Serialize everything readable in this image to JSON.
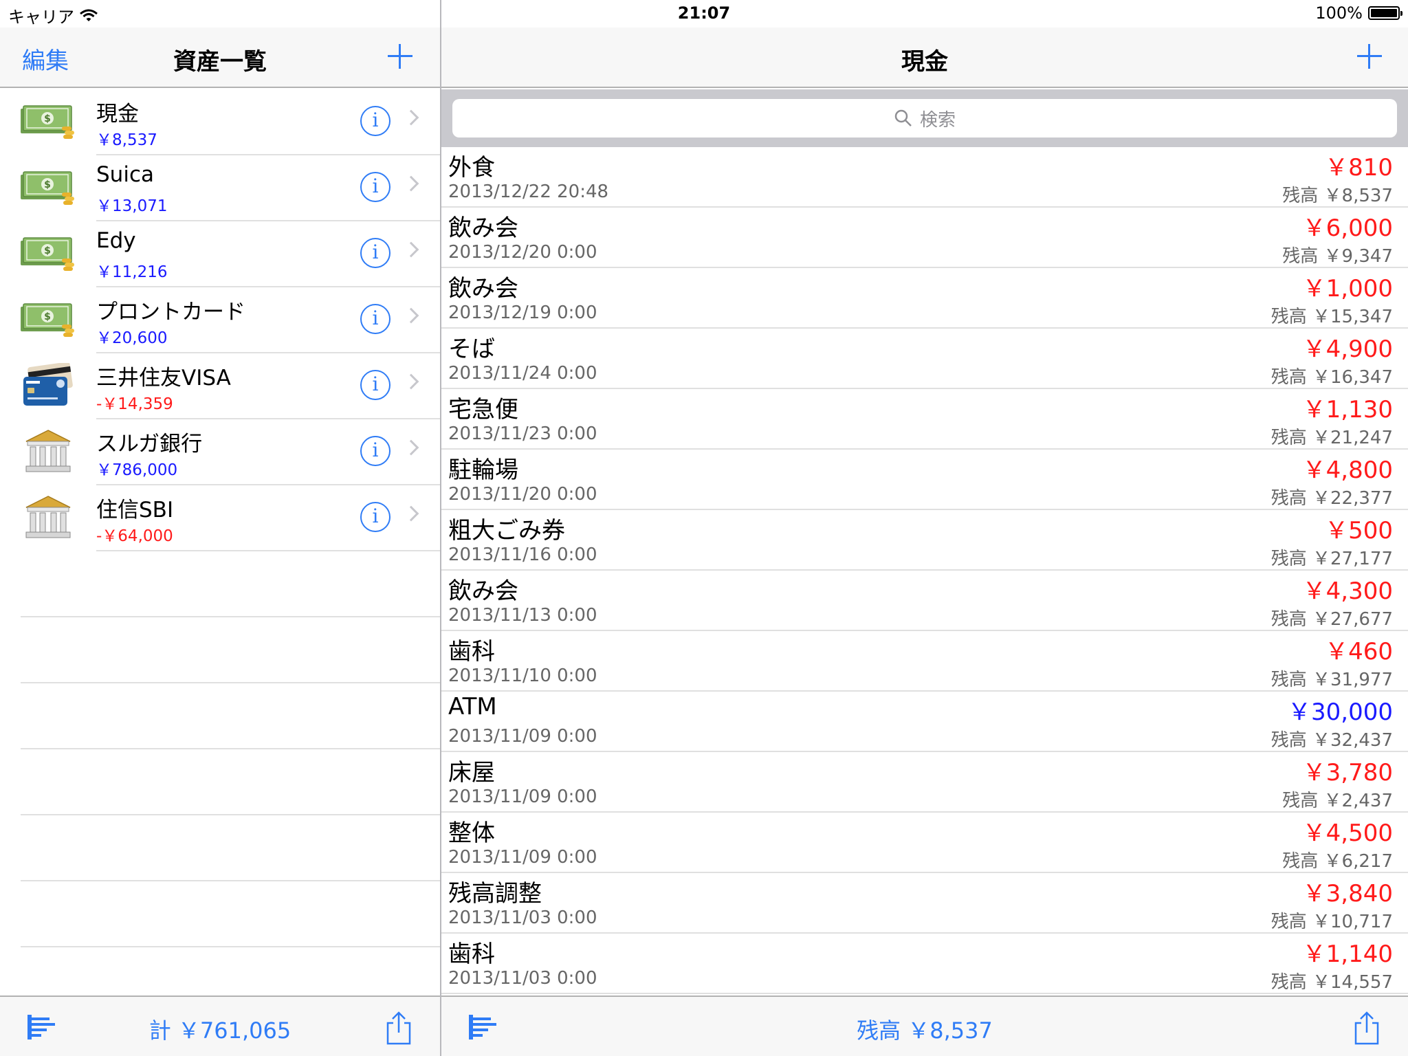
{
  "status": {
    "carrier": "キャリア",
    "time": "21:07",
    "battery": "100%"
  },
  "left": {
    "nav": {
      "edit_label": "編集",
      "title": "資産一覧"
    },
    "assets": [
      {
        "name": "現金",
        "amount": "￥8,537",
        "type": "cash"
      },
      {
        "name": "Suica",
        "amount": "￥13,071",
        "type": "cash"
      },
      {
        "name": "Edy",
        "amount": "￥11,216",
        "type": "cash"
      },
      {
        "name": "プロントカード",
        "amount": "￥20,600",
        "type": "cash"
      },
      {
        "name": "三井住友VISA",
        "amount": "-￥14,359",
        "type": "card"
      },
      {
        "name": "スルガ銀行",
        "amount": "￥786,000",
        "type": "bank"
      },
      {
        "name": "住信SBI",
        "amount": "-￥64,000",
        "type": "bank"
      }
    ],
    "toolbar": {
      "total": "計 ￥761,065"
    }
  },
  "right": {
    "nav": {
      "title": "現金"
    },
    "search": {
      "placeholder": "検索"
    },
    "transactions": [
      {
        "name": "外食",
        "date": "2013/12/22 20:48",
        "amount": "￥810",
        "balance": "残高 ￥8,537"
      },
      {
        "name": "飲み会",
        "date": "2013/12/20 0:00",
        "amount": "￥6,000",
        "balance": "残高 ￥9,347"
      },
      {
        "name": "飲み会",
        "date": "2013/12/19 0:00",
        "amount": "￥1,000",
        "balance": "残高 ￥15,347"
      },
      {
        "name": "そば",
        "date": "2013/11/24 0:00",
        "amount": "￥4,900",
        "balance": "残高 ￥16,347"
      },
      {
        "name": "宅急便",
        "date": "2013/11/23 0:00",
        "amount": "￥1,130",
        "balance": "残高 ￥21,247"
      },
      {
        "name": "駐輪場",
        "date": "2013/11/20 0:00",
        "amount": "￥4,800",
        "balance": "残高 ￥22,377"
      },
      {
        "name": "粗大ごみ券",
        "date": "2013/11/16 0:00",
        "amount": "￥500",
        "balance": "残高 ￥27,177"
      },
      {
        "name": "飲み会",
        "date": "2013/11/13 0:00",
        "amount": "￥4,300",
        "balance": "残高 ￥27,677"
      },
      {
        "name": "歯科",
        "date": "2013/11/10 0:00",
        "amount": "￥460",
        "balance": "残高 ￥31,977"
      },
      {
        "name": "ATM",
        "date": "2013/11/09 0:00",
        "amount": "￥30,000",
        "balance": "残高 ￥32,437",
        "income": true
      },
      {
        "name": "床屋",
        "date": "2013/11/09 0:00",
        "amount": "￥3,780",
        "balance": "残高 ￥2,437"
      },
      {
        "name": "整体",
        "date": "2013/11/09 0:00",
        "amount": "￥4,500",
        "balance": "残高 ￥6,217"
      },
      {
        "name": "残高調整",
        "date": "2013/11/03 0:00",
        "amount": "￥3,840",
        "balance": "残高 ￥10,717"
      },
      {
        "name": "歯科",
        "date": "2013/11/03 0:00",
        "amount": "￥1,140",
        "balance": "残高 ￥14,557"
      }
    ],
    "toolbar": {
      "balance": "残高 ￥8,537"
    }
  },
  "colors": {
    "accent": "#2f7cf6",
    "expense": "#ff1a1a",
    "income": "#1a1aff"
  },
  "icons": {
    "cash": "money-bills-icon",
    "card": "credit-card-icon",
    "bank": "bank-building-icon"
  }
}
